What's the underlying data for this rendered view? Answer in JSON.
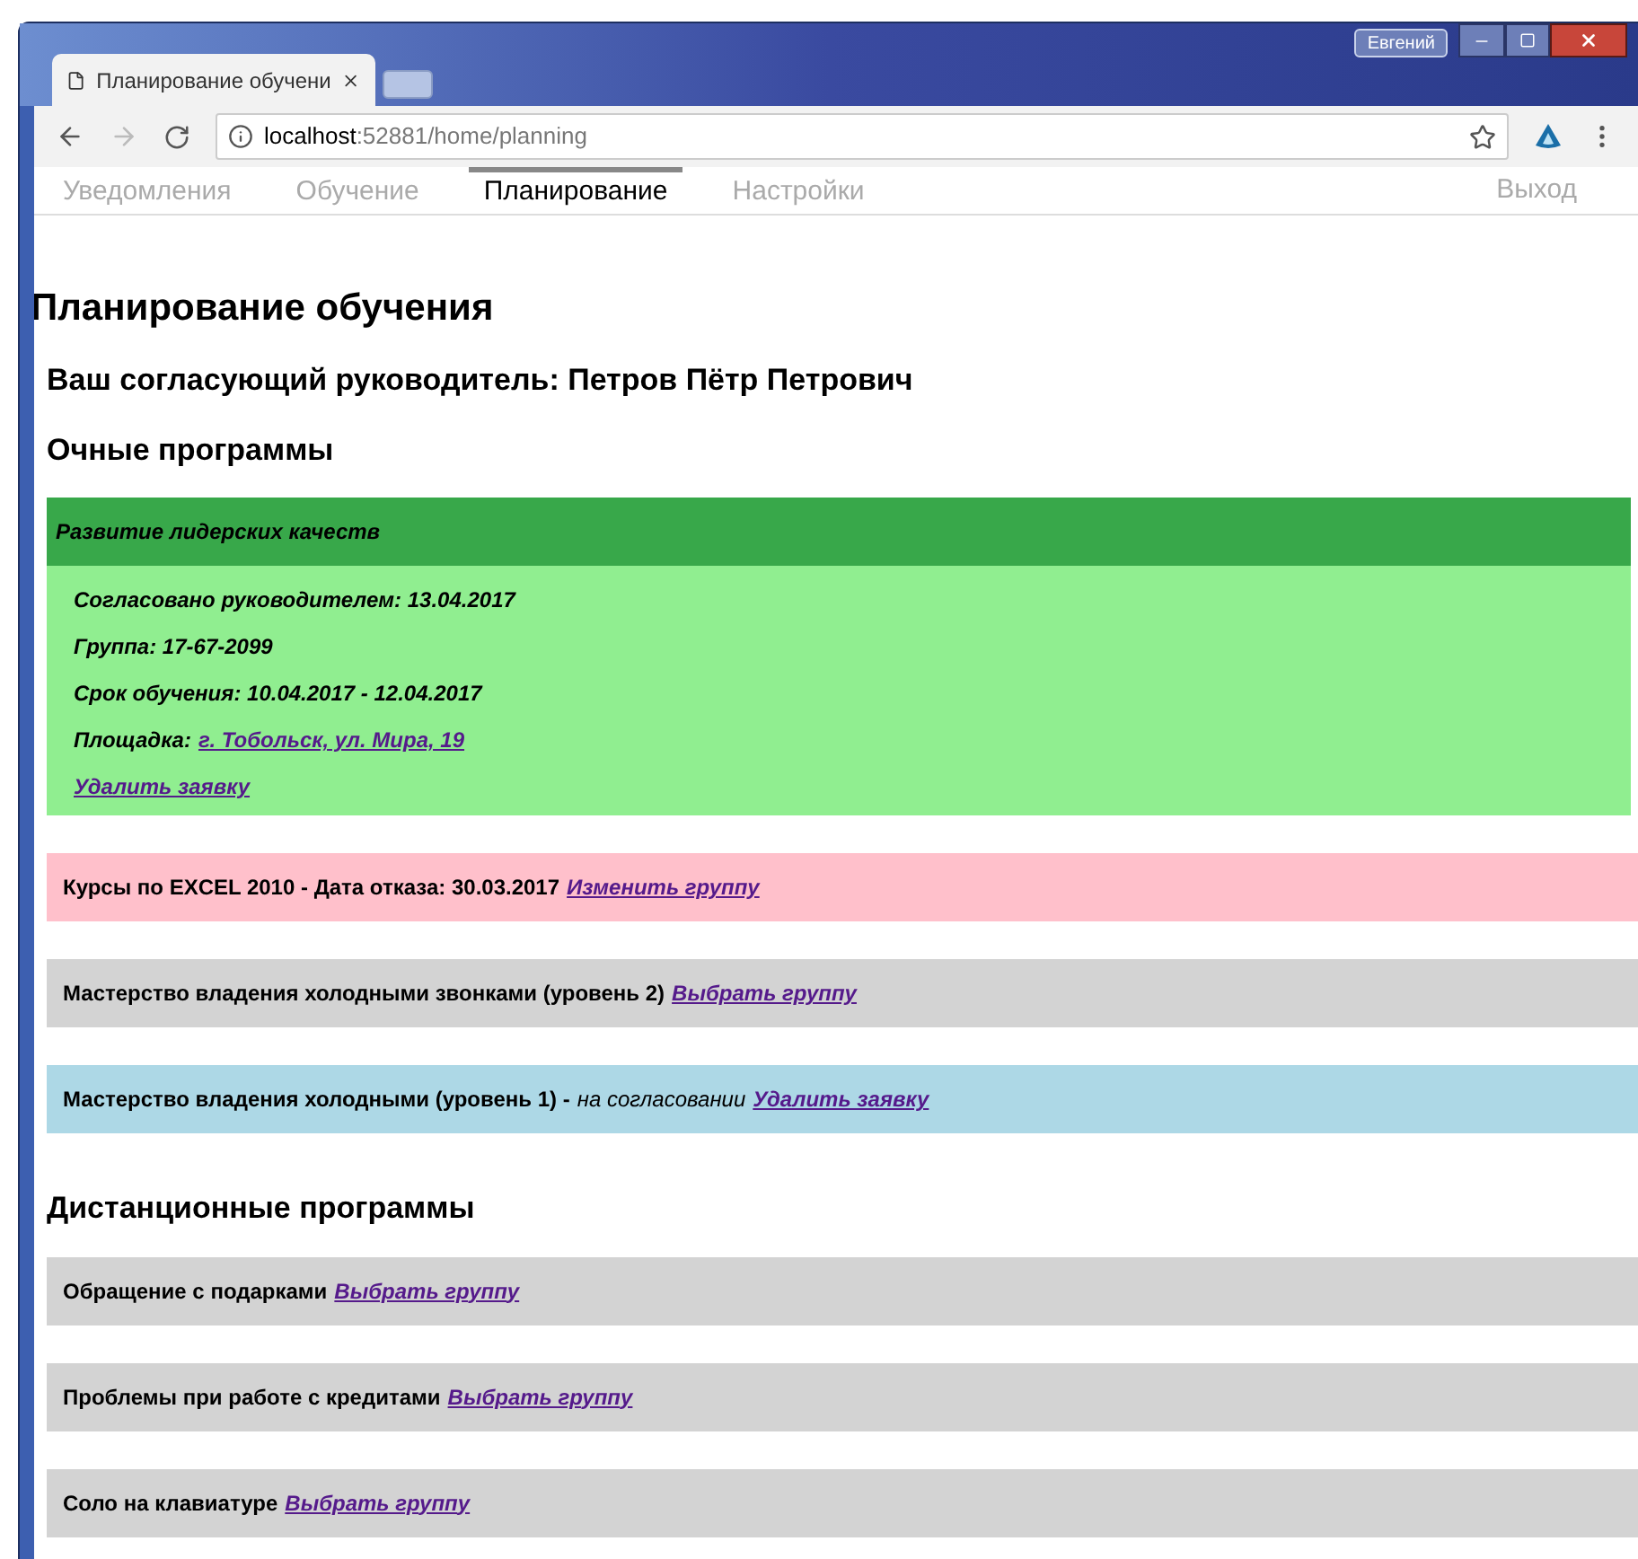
{
  "browser": {
    "profile": "Евгений",
    "tab_title": "Планирование обучени",
    "url_host": "localhost",
    "url_rest": ":52881/home/planning"
  },
  "nav": {
    "items": [
      {
        "label": "Уведомления",
        "selected": false
      },
      {
        "label": "Обучение",
        "selected": false
      },
      {
        "label": "Планирование",
        "selected": true
      },
      {
        "label": "Настройки",
        "selected": false
      }
    ],
    "logout": "Выход"
  },
  "title": "Планирование обучения",
  "manager": "Ваш согласующий руководитель: Петров Пётр Петрович",
  "sections": [
    {
      "title": "Очные программы",
      "programs": [
        {
          "kind": "expanded",
          "header": "Развитие лидерских качеств",
          "details": [
            "Согласовано руководителем: 13.04.2017",
            "Группа: 17-67-2099",
            "Срок обучения: 10.04.2017 - 12.04.2017"
          ],
          "location_label": "Площадка:",
          "location_link": "г. Тобольск, ул. Мира, 19",
          "link": "Удалить заявку"
        },
        {
          "kind": "line",
          "color": "#ffc0cb",
          "text": "Курсы по EXCEL 2010 - Дата отказа: 30.03.2017",
          "link": "Изменить группу"
        },
        {
          "kind": "line",
          "color": "#d3d3d3",
          "text": "Мастерство владения холодными звонками (уровень 2)",
          "link": "Выбрать группу"
        },
        {
          "kind": "line",
          "color": "#add8e6",
          "text": "Мастерство владения холодными (уровень 1) -",
          "status": "на согласовании",
          "link": "Удалить заявку"
        }
      ]
    },
    {
      "title": "Дистанционные программы",
      "programs": [
        {
          "kind": "line",
          "color": "#d3d3d3",
          "text": "Обращение с подарками",
          "link": "Выбрать группу"
        },
        {
          "kind": "line",
          "color": "#d3d3d3",
          "text": "Проблемы при работе с кредитами",
          "link": "Выбрать группу"
        },
        {
          "kind": "line",
          "color": "#d3d3d3",
          "text": "Соло на клавиатуре",
          "link": "Выбрать группу"
        }
      ]
    }
  ]
}
